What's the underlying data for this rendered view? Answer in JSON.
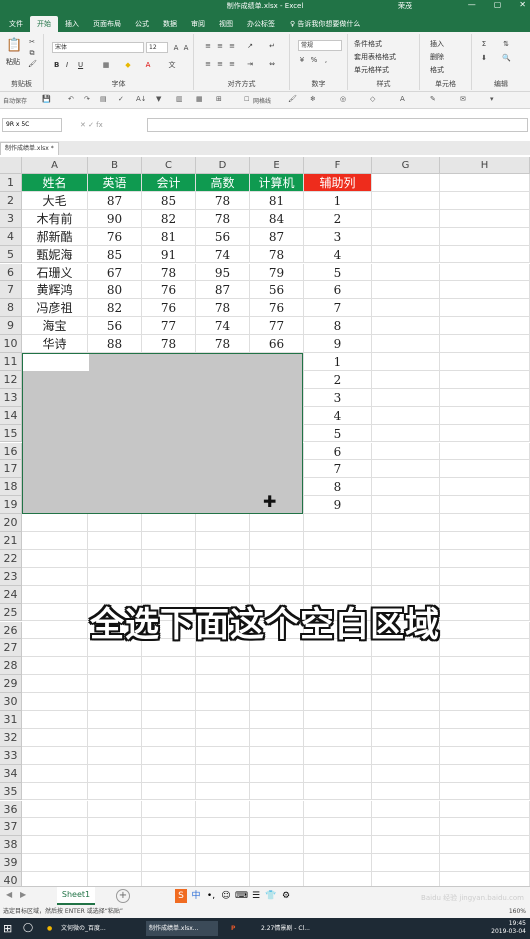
{
  "window": {
    "title": "制作成绩单.xlsx - Excel",
    "user": "荣茂",
    "controls": [
      "—",
      "▢",
      "✕"
    ]
  },
  "ribbon_tabs": [
    "文件",
    "开始",
    "插入",
    "页面布局",
    "公式",
    "数据",
    "审阅",
    "视图",
    "办公标签"
  ],
  "tell_me": "♀ 告诉我你想要做什么",
  "ribbon": {
    "paste": "粘贴",
    "clipboard": "剪贴板",
    "font_name": "宋体",
    "font_size": "12",
    "font_group": "字体",
    "bold": "B",
    "italic": "I",
    "underline": "U",
    "align_group": "对齐方式",
    "number_format": "常规",
    "number_group": "数字",
    "cond_format": "条件格式",
    "table_format": "套用表格格式",
    "cell_style": "单元格样式",
    "style_group": "样式",
    "insert": "插入",
    "delete": "删除",
    "format": "格式",
    "cells_group": "单元格",
    "edit_group": "编辑"
  },
  "qat": {
    "autosave": "自动保存",
    "gridlines": "网格线"
  },
  "formula_bar": {
    "name_box": "9R x 5C",
    "fx": "✕  ✓  fx",
    "value": ""
  },
  "file_tab": "制作成绩单.xlsx *",
  "columns": [
    "A",
    "B",
    "C",
    "D",
    "E",
    "F",
    "G",
    "H"
  ],
  "rows": [
    "1",
    "2",
    "3",
    "4",
    "5",
    "6",
    "7",
    "8",
    "9",
    "10",
    "11",
    "12",
    "13",
    "14",
    "15",
    "16",
    "17",
    "18",
    "19",
    "20",
    "21",
    "22",
    "23",
    "24",
    "25",
    "26",
    "27",
    "28",
    "29",
    "30",
    "31",
    "32",
    "33",
    "34",
    "35",
    "36",
    "37",
    "38",
    "39",
    "40"
  ],
  "table": {
    "headers": [
      "姓名",
      "英语",
      "会计",
      "高数",
      "计算机",
      "辅助列"
    ],
    "data": [
      [
        "大毛",
        "87",
        "85",
        "78",
        "81",
        "1"
      ],
      [
        "木有前",
        "90",
        "82",
        "78",
        "84",
        "2"
      ],
      [
        "郝新酷",
        "76",
        "81",
        "56",
        "87",
        "3"
      ],
      [
        "甄妮海",
        "85",
        "91",
        "74",
        "78",
        "4"
      ],
      [
        "石珊义",
        "67",
        "78",
        "95",
        "79",
        "5"
      ],
      [
        "黄辉鸿",
        "80",
        "76",
        "87",
        "56",
        "6"
      ],
      [
        "冯彦祖",
        "82",
        "76",
        "78",
        "76",
        "7"
      ],
      [
        "海宝",
        "56",
        "77",
        "74",
        "77",
        "8"
      ],
      [
        "华诗",
        "88",
        "78",
        "78",
        "66",
        "9"
      ]
    ],
    "helper_extra": [
      "1",
      "2",
      "3",
      "4",
      "5",
      "6",
      "7",
      "8",
      "9"
    ]
  },
  "caption": "全选下面这个空白区域",
  "sheet_tab": "Sheet1",
  "add_sheet": "+",
  "ime_icons": [
    "S",
    "中",
    "•,",
    "☺",
    "⌨",
    "☰",
    "👕",
    "⚙"
  ],
  "status": {
    "message": "选定目标区域，然后按 ENTER 或选择“粘贴”",
    "zoom": "160%"
  },
  "taskbar": {
    "items": [
      "⊞",
      "文何微の_百度...",
      "制作成绩单.xlsx...",
      "P",
      "2.27情景剧 - Cl..."
    ],
    "time": "19:45",
    "date": "2019-03-04"
  },
  "watermark": "Baidu 经验 jingyan.baidu.com",
  "colors": {
    "excel_green": "#217346",
    "header_green": "#0f9a50",
    "helper_red": "#ee2c1c",
    "selection_gray": "#c6c6c6"
  }
}
